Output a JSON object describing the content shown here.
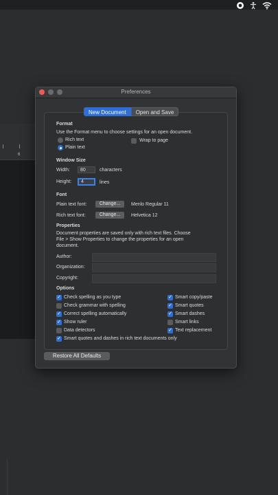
{
  "window": {
    "title": "Preferences"
  },
  "tabs": {
    "new_document": "New Document",
    "open_and_save": "Open and Save"
  },
  "format": {
    "heading": "Format",
    "description": "Use the Format menu to choose settings for an open document.",
    "rich_text": "Rich text",
    "plain_text": "Plain text",
    "selected": "Plain text",
    "wrap_to_page": "Wrap to page"
  },
  "window_size": {
    "heading": "Window Size",
    "width_label": "Width:",
    "width_value": "80",
    "width_unit": "characters",
    "height_label": "Height:",
    "height_value": "4",
    "height_unit": "lines"
  },
  "font": {
    "heading": "Font",
    "plain_label": "Plain text font:",
    "plain_button": "Change...",
    "plain_value": "Menlo Regular 11",
    "rich_label": "Rich text font:",
    "rich_button": "Change...",
    "rich_value": "Helvetica 12"
  },
  "properties": {
    "heading": "Properties",
    "line1": "Document properties are saved only with rich text files. Choose",
    "line2": "File > Show Properties to change the properties for an open",
    "line3": "document.",
    "author_label": "Author:",
    "author_value": "",
    "organization_label": "Organization:",
    "organization_value": "",
    "copyright_label": "Copyright:",
    "copyright_value": ""
  },
  "options": {
    "heading": "Options",
    "check_spelling": "Check spelling as you type",
    "check_grammar": "Check grammar with spelling",
    "correct_spelling": "Correct spelling automatically",
    "show_ruler": "Show ruler",
    "data_detectors": "Data detectors",
    "smart_quotes_rich": "Smart quotes and dashes in rich text documents only",
    "smart_copy_paste": "Smart copy/paste",
    "smart_quotes": "Smart quotes",
    "smart_dashes": "Smart dashes",
    "smart_links": "Smart links",
    "text_replacement": "Text replacement",
    "checkmark": "✓"
  },
  "footer": {
    "restore_defaults": "Restore All Defaults"
  },
  "ruler": {
    "mark": "6"
  },
  "colors": {
    "accent": "#2d6fd6",
    "close": "#ee5b57"
  }
}
